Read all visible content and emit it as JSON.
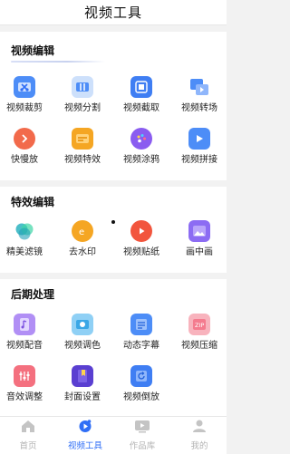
{
  "header": {
    "title": "视频工具"
  },
  "sections": [
    {
      "title": "视频编辑",
      "items": [
        {
          "label": "视频裁剪",
          "icon": "video-crop-icon"
        },
        {
          "label": "视频分割",
          "icon": "video-split-icon"
        },
        {
          "label": "视频截取",
          "icon": "video-capture-icon"
        },
        {
          "label": "视频转场",
          "icon": "video-transition-icon"
        },
        {
          "label": "快慢放",
          "icon": "speed-icon"
        },
        {
          "label": "视频特效",
          "icon": "effects-icon"
        },
        {
          "label": "视频涂鸦",
          "icon": "doodle-palette-icon"
        },
        {
          "label": "视频拼接",
          "icon": "video-merge-icon"
        }
      ]
    },
    {
      "title": "特效编辑",
      "items": [
        {
          "label": "精美滤镜",
          "icon": "filter-icon"
        },
        {
          "label": "去水印",
          "icon": "watermark-remove-icon"
        },
        {
          "label": "视频贴纸",
          "icon": "sticker-icon"
        },
        {
          "label": "画中画",
          "icon": "picture-in-picture-icon"
        }
      ]
    },
    {
      "title": "后期处理",
      "items": [
        {
          "label": "视频配音",
          "icon": "dubbing-icon"
        },
        {
          "label": "视频调色",
          "icon": "color-grade-icon"
        },
        {
          "label": "动态字幕",
          "icon": "subtitle-icon"
        },
        {
          "label": "视频压缩",
          "icon": "compress-zip-icon"
        },
        {
          "label": "音效调整",
          "icon": "sound-adjust-icon"
        },
        {
          "label": "封面设置",
          "icon": "cover-icon"
        },
        {
          "label": "视频倒放",
          "icon": "reverse-icon"
        }
      ]
    }
  ],
  "tabs": [
    {
      "label": "首页",
      "icon": "home-icon",
      "active": false
    },
    {
      "label": "视频工具",
      "icon": "video-tools-icon",
      "active": true
    },
    {
      "label": "作品库",
      "icon": "works-library-icon",
      "active": false
    },
    {
      "label": "我的",
      "icon": "profile-icon",
      "active": false
    }
  ],
  "colors": {
    "accent": "#2f6ef6",
    "tab_inactive": "#b3b3b3",
    "background": "#f2f2f2"
  }
}
